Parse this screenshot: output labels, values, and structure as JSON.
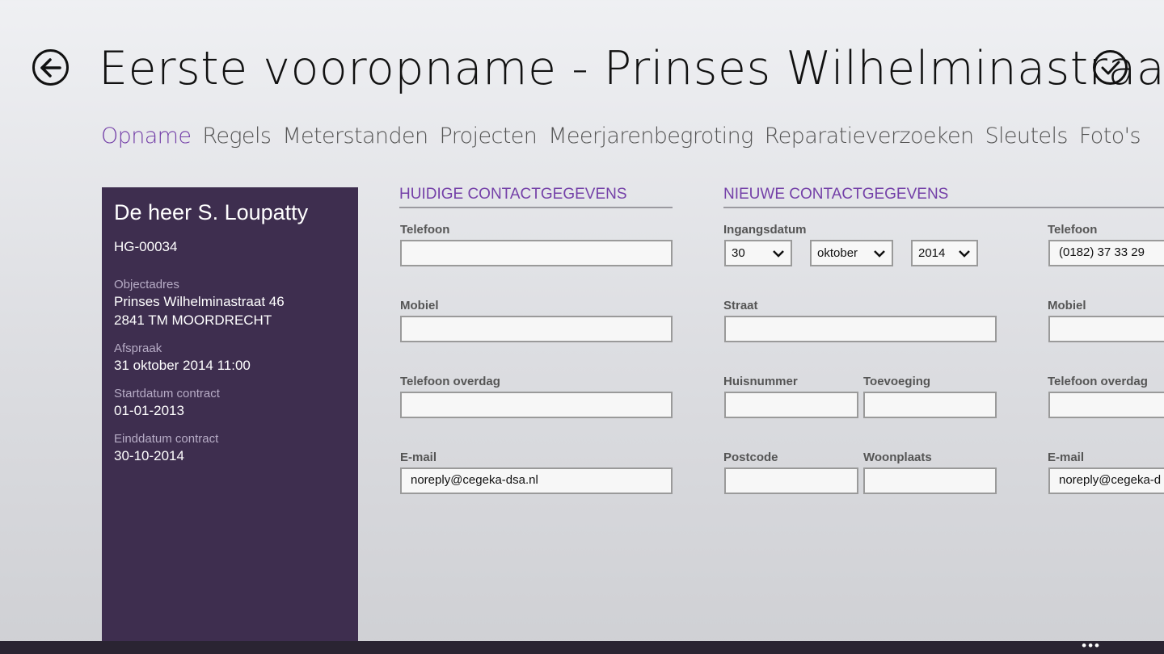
{
  "header": {
    "title": "Eerste vooropname - Prinses Wilhelminastraa.."
  },
  "tabs": [
    {
      "label": "Opname",
      "active": true
    },
    {
      "label": "Regels"
    },
    {
      "label": "Meterstanden"
    },
    {
      "label": "Projecten"
    },
    {
      "label": "Meerjarenbegroting"
    },
    {
      "label": "Reparatieverzoeken"
    },
    {
      "label": "Sleutels"
    },
    {
      "label": "Foto's"
    }
  ],
  "panel": {
    "name": "De heer S. Loupatty",
    "code": "HG-00034",
    "object_label": "Objectadres",
    "object_line1": "Prinses Wilhelminastraat 46",
    "object_line2": "2841 TM MOORDRECHT",
    "appointment_label": "Afspraak",
    "appointment_value": "31 oktober 2014 11:00",
    "start_label": "Startdatum contract",
    "start_value": "01-01-2013",
    "end_label": "Einddatum contract",
    "end_value": "30-10-2014"
  },
  "current": {
    "title": "HUIDIGE CONTACTGEGEVENS",
    "phone_label": "Telefoon",
    "phone_value": "",
    "mobile_label": "Mobiel",
    "mobile_value": "",
    "dayphone_label": "Telefoon overdag",
    "dayphone_value": "",
    "email_label": "E-mail",
    "email_value": "noreply@cegeka-dsa.nl"
  },
  "new": {
    "title": "NIEUWE CONTACTGEGEVENS",
    "date_label": "Ingangsdatum",
    "day": "30",
    "month": "oktober",
    "year": "2014",
    "street_label": "Straat",
    "street_value": "",
    "housenumber_label": "Huisnummer",
    "housenumber_value": "",
    "addition_label": "Toevoeging",
    "addition_value": "",
    "postcode_label": "Postcode",
    "postcode_value": "",
    "city_label": "Woonplaats",
    "city_value": "",
    "phone_label": "Telefoon",
    "phone_value": "(0182) 37 33 29",
    "mobile_label": "Mobiel",
    "mobile_value": "",
    "dayphone_label": "Telefoon overdag",
    "dayphone_value": "",
    "email_label": "E-mail",
    "email_value": "noreply@cegeka-d"
  },
  "appbar": {
    "more_label": "•••"
  },
  "colors": {
    "accent": "#7440a8",
    "panel_bg": "#3e2e4f",
    "appbar_bg": "#2a2432"
  },
  "icons": {
    "back": "back-arrow-icon",
    "confirm": "checkmark-icon",
    "dropdown": "chevron-down-icon"
  }
}
